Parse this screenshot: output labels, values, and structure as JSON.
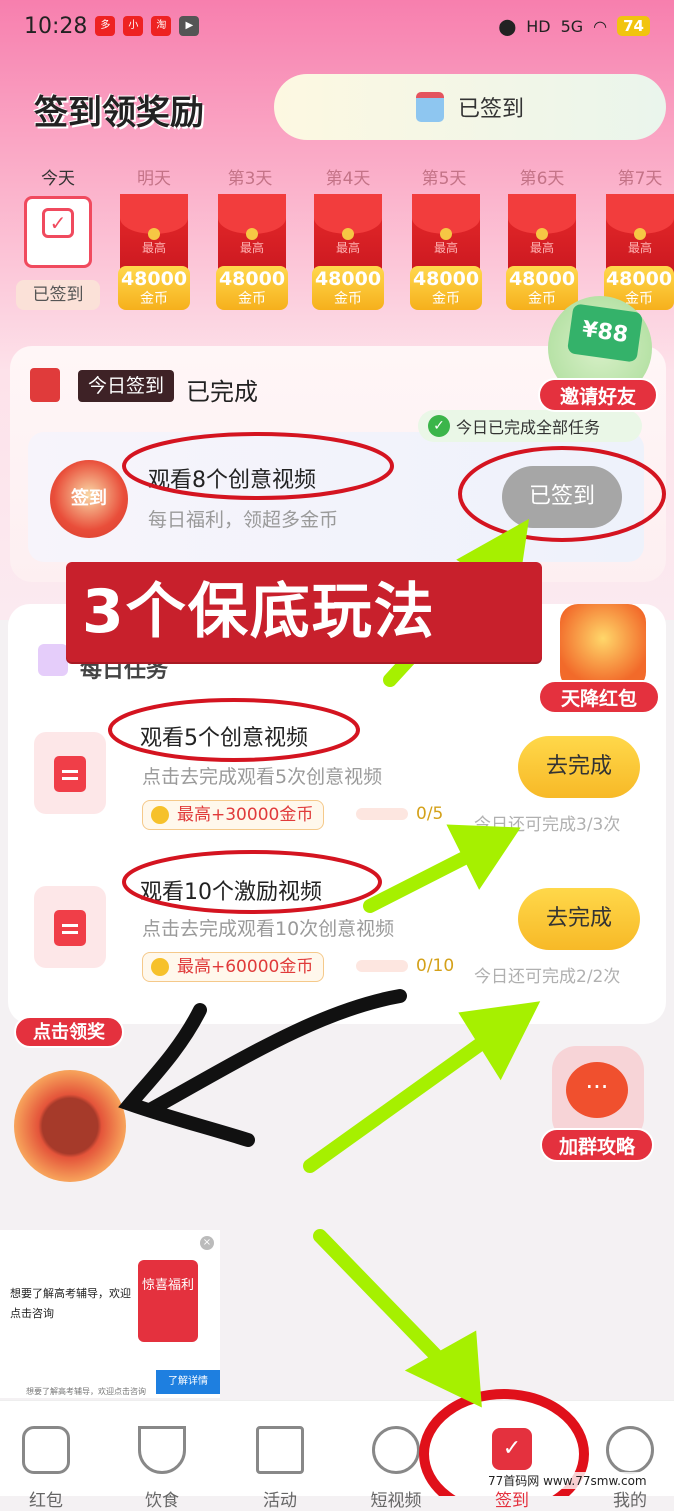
{
  "status": {
    "time": "10:28",
    "network": "5G",
    "battery": "74"
  },
  "header": {
    "title": "签到领奖励",
    "signed_label": "已签到"
  },
  "days": {
    "labels": [
      "今天",
      "明天",
      "第3天",
      "第4天",
      "第5天",
      "第6天",
      "第7天"
    ],
    "today_signed": "已签到",
    "max_label": "最高",
    "coin_amount": "48000",
    "coin_unit": "金币"
  },
  "today_section": {
    "tag": "今日签到",
    "status": "已完成",
    "all_done": "今日已完成全部任务",
    "task_title": "观看8个创意视频",
    "task_desc": "每日福利，领超多金币",
    "badge": "签到",
    "button": "已签到"
  },
  "banner": "3个保底玩法",
  "daily": {
    "title": "每日任务",
    "tasks": [
      {
        "title": "观看5个创意视频",
        "desc": "点击去完成观看5次创意视频",
        "reward": "最高+30000金币",
        "progress": "0/5",
        "progress_value": 0,
        "button": "去完成",
        "remain": "今日还可完成3/3次"
      },
      {
        "title": "观看10个激励视频",
        "desc": "点击去完成观看10次创意视频",
        "reward": "最高+60000金币",
        "progress": "0/10",
        "progress_value": 0,
        "button": "去完成",
        "remain": "今日还可完成2/2次"
      }
    ]
  },
  "floats": {
    "invite_amount": "¥88",
    "invite": "邀请好友",
    "red_rain": "天降红包",
    "group": "加群攻略",
    "click_reward": "点击领奖"
  },
  "ad": {
    "text": "想要了解高考辅导，欢迎点击咨询",
    "card": "惊喜福利",
    "button": "了解详情",
    "small": "想要了解高考辅导，欢迎点击咨询"
  },
  "nav": {
    "items": [
      "红包",
      "饮食",
      "活动",
      "短视频",
      "签到",
      "我的"
    ]
  },
  "watermark": "77首码网 www.77smw.com"
}
